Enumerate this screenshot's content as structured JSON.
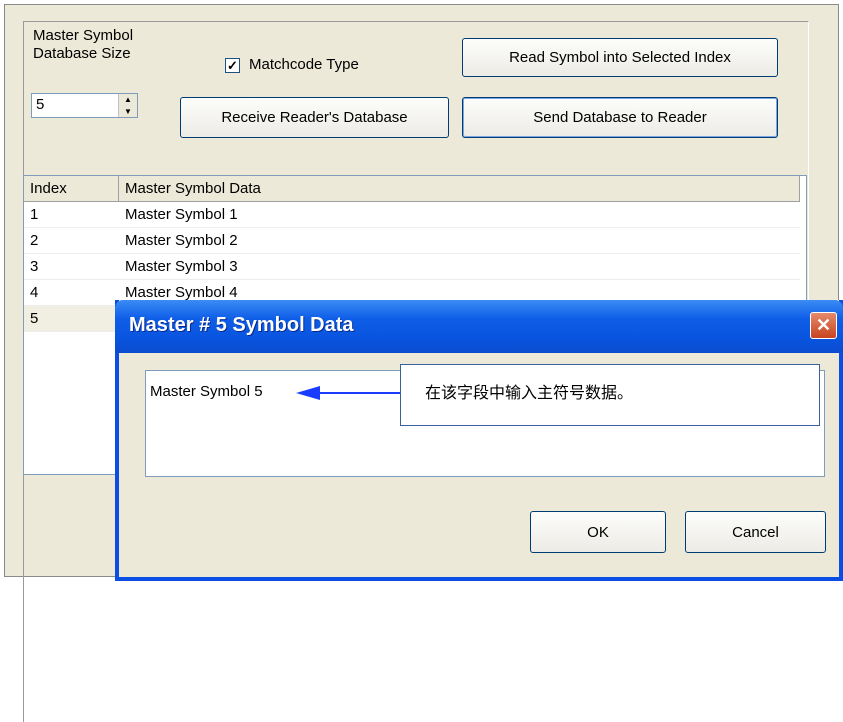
{
  "db_size_label_line1": "Master Symbol",
  "db_size_label_line2": "Database Size",
  "db_size_value": "5",
  "matchcode": {
    "checked": true,
    "label": "Matchcode Type"
  },
  "buttons": {
    "read_symbol": "Read Symbol into Selected Index",
    "receive_db": "Receive Reader's Database",
    "send_db": "Send Database to Reader"
  },
  "table": {
    "columns": [
      "Index",
      "Master Symbol Data"
    ],
    "rows": [
      {
        "index": "1",
        "data": "Master Symbol 1"
      },
      {
        "index": "2",
        "data": "Master Symbol 2"
      },
      {
        "index": "3",
        "data": "Master Symbol 3"
      },
      {
        "index": "4",
        "data": "Master Symbol 4"
      },
      {
        "index": "5",
        "data": ""
      }
    ]
  },
  "dialog": {
    "title": "Master # 5 Symbol Data",
    "input_value": "Master Symbol 5",
    "ok": "OK",
    "cancel": "Cancel",
    "close_glyph": "✕"
  },
  "callout_text": "在该字段中输入主符号数据。",
  "colors": {
    "panel": "#ece9d8",
    "title_blue": "#0a4ee3",
    "callout_arrow": "#1a3cff"
  }
}
